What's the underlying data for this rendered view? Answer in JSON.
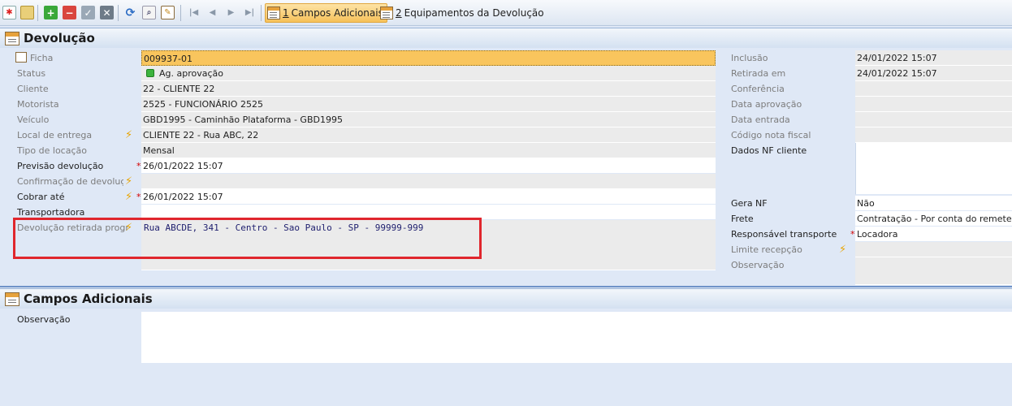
{
  "toolbar": {
    "tabs": [
      {
        "num": "1",
        "label": "Campos Adicionais",
        "active": true
      },
      {
        "num": "2",
        "label": "Equipamentos da Devolução",
        "active": false
      }
    ],
    "icons": [
      "new-record-icon",
      "lock-icon",
      "add-icon",
      "remove-icon",
      "confirm-icon",
      "cancel-icon",
      "refresh-icon",
      "preview-icon",
      "edit-icon",
      "first-icon",
      "prev-icon",
      "next-icon",
      "last-icon"
    ]
  },
  "devolucao": {
    "title": "Devolução",
    "left": [
      {
        "label": "Ficha",
        "value": "009937-01"
      },
      {
        "label": "Status",
        "value": "Ag. aprovação"
      },
      {
        "label": "Cliente",
        "value": "22 - CLIENTE 22"
      },
      {
        "label": "Motorista",
        "value": "2525 - FUNCIONÁRIO  2525"
      },
      {
        "label": "Veículo",
        "value": "GBD1995 - Caminhão Plataforma - GBD1995"
      },
      {
        "label": "Local de entrega",
        "value": "CLIENTE 22 - Rua ABC, 22"
      },
      {
        "label": "Tipo de locação",
        "value": "Mensal"
      },
      {
        "label": "Previsão devolução",
        "value": "26/01/2022 15:07"
      },
      {
        "label": "Confirmação de devolução",
        "value": ""
      },
      {
        "label": "Cobrar até",
        "value": "26/01/2022 15:07"
      },
      {
        "label": "Transportadora",
        "value": ""
      },
      {
        "label": "Devolução retirada programada",
        "value": "Rua ABCDE, 341 - Centro - Sao Paulo - SP - 99999-999"
      }
    ],
    "right": [
      {
        "label": "Inclusão",
        "value": "24/01/2022 15:07"
      },
      {
        "label": "Retirada em",
        "value": "24/01/2022 15:07"
      },
      {
        "label": "Conferência",
        "value": ""
      },
      {
        "label": "Data aprovação",
        "value": ""
      },
      {
        "label": "Data entrada",
        "value": ""
      },
      {
        "label": "Código nota fiscal",
        "value": ""
      },
      {
        "label": "Dados NF cliente",
        "value": ""
      },
      {
        "label": "Gera NF",
        "value": "Não"
      },
      {
        "label": "Frete",
        "value": "Contratação - Por conta do remetente (CIF)"
      },
      {
        "label": "Responsável transporte",
        "value": "Locadora"
      },
      {
        "label": "Limite recepção",
        "value": ""
      },
      {
        "label": "Observação",
        "value": ""
      }
    ]
  },
  "campos": {
    "title": "Campos Adicionais",
    "observacao_label": "Observação",
    "observacao_value": ""
  }
}
